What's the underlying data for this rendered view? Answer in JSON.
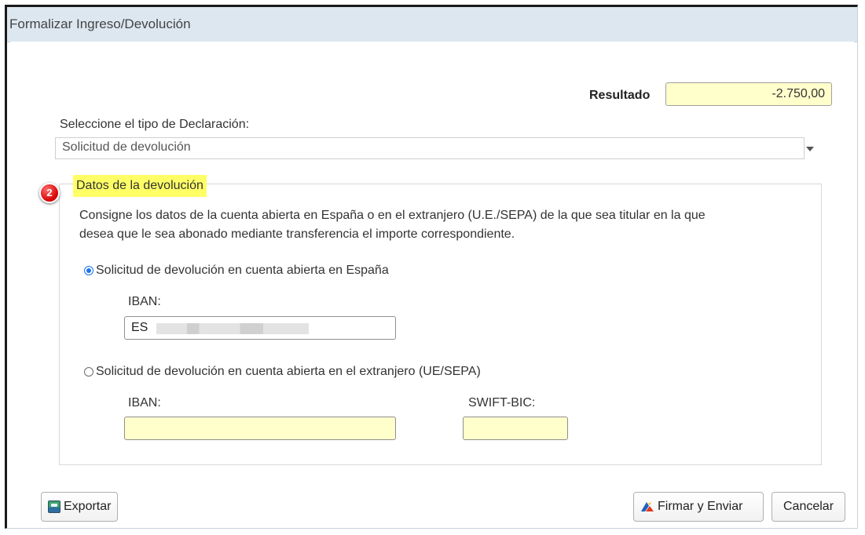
{
  "window": {
    "title": "Formalizar Ingreso/Devolución"
  },
  "result": {
    "label": "Resultado",
    "value": "-2.750,00"
  },
  "declaration": {
    "label": "Seleccione el tipo de Declaración:",
    "selected": "Solicitud de devolución"
  },
  "refund": {
    "step_number": "2",
    "legend": "Datos de la devolución",
    "description_line1": "Consigne los datos de la cuenta abierta en España o en el extranjero (U.E./SEPA) de la que sea titular en la que",
    "description_line2": "desea que le sea abonado mediante transferencia el importe correspondiente.",
    "spain": {
      "radio_label": "Solicitud de devolución en cuenta abierta en España",
      "checked": true,
      "iban_label": "IBAN:",
      "iban_value": "ES"
    },
    "abroad": {
      "radio_label": "Solicitud de devolución en cuenta abierta en el extranjero (UE/SEPA)",
      "checked": false,
      "iban_label": "IBAN:",
      "iban_value": "",
      "swift_label": "SWIFT-BIC:",
      "swift_value": ""
    }
  },
  "buttons": {
    "export": "Exportar",
    "sign_send": "Firmar y Enviar",
    "cancel": "Cancelar"
  },
  "colors": {
    "titlebar": "#dde7f0",
    "input_highlight": "#ffffcc",
    "legend_highlight": "#ffff66",
    "badge": "#d40000",
    "radio_accent": "#1a73e8"
  },
  "icons": {
    "export": "export-icon",
    "sign": "signature-icon",
    "dropdown": "chevron-down-icon",
    "step": "step-badge-icon"
  }
}
